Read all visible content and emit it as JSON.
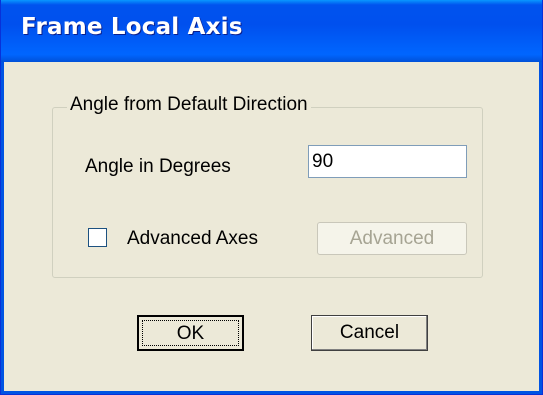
{
  "window": {
    "title": "Frame Local Axis"
  },
  "group": {
    "legend": "Angle from Default Direction",
    "angle_label": "Angle in Degrees",
    "angle_value": "90",
    "advanced_axes_label": "Advanced Axes",
    "advanced_axes_checked": false,
    "advanced_button_label": "Advanced"
  },
  "buttons": {
    "ok_label": "OK",
    "cancel_label": "Cancel"
  },
  "colors": {
    "titlebar": "#0054e3",
    "dialog_background": "#ece9d8",
    "disabled_text": "#a6a493"
  }
}
